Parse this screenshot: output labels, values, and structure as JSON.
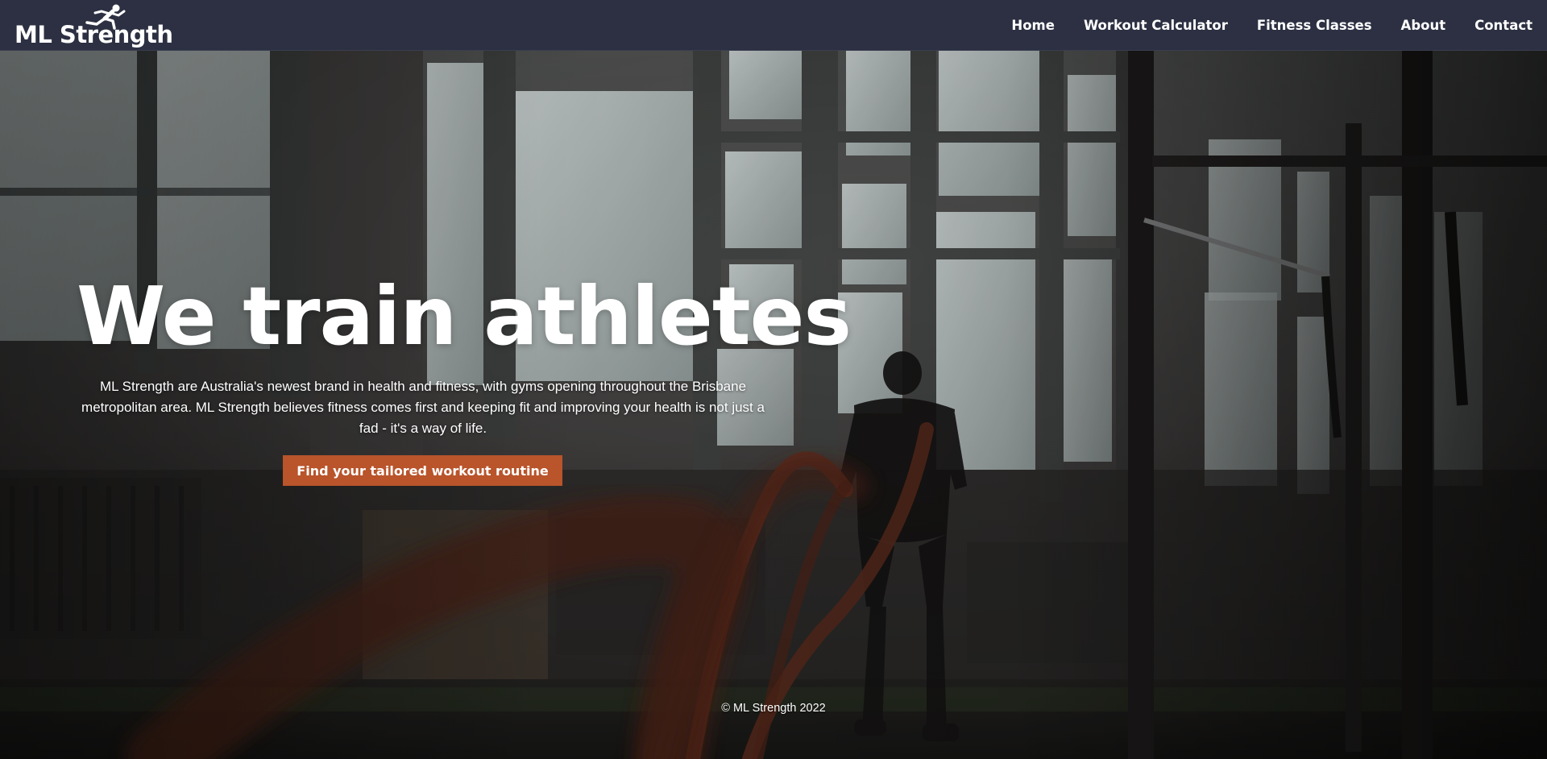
{
  "brand": {
    "name": "ML Strength",
    "logo_icon": "sprinter-icon"
  },
  "nav": {
    "items": [
      {
        "label": "Home"
      },
      {
        "label": "Workout Calculator"
      },
      {
        "label": "Fitness Classes"
      },
      {
        "label": "About"
      },
      {
        "label": "Contact"
      }
    ]
  },
  "hero": {
    "title": "We train athletes",
    "description": "ML Strength are Australia's newest brand in health and fitness, with gyms opening throughout the Brisbane metropolitan area. ML Strength believes fitness comes first and keeping fit and improving your health is not just a fad - it's a way of life.",
    "cta_label": "Find your tailored workout routine",
    "background": "gym-battle-ropes-photo"
  },
  "footer": {
    "copyright": "© ML Strength 2022"
  },
  "colors": {
    "navbar": "#2c3042",
    "cta": "#b9542b",
    "text": "#ffffff"
  }
}
